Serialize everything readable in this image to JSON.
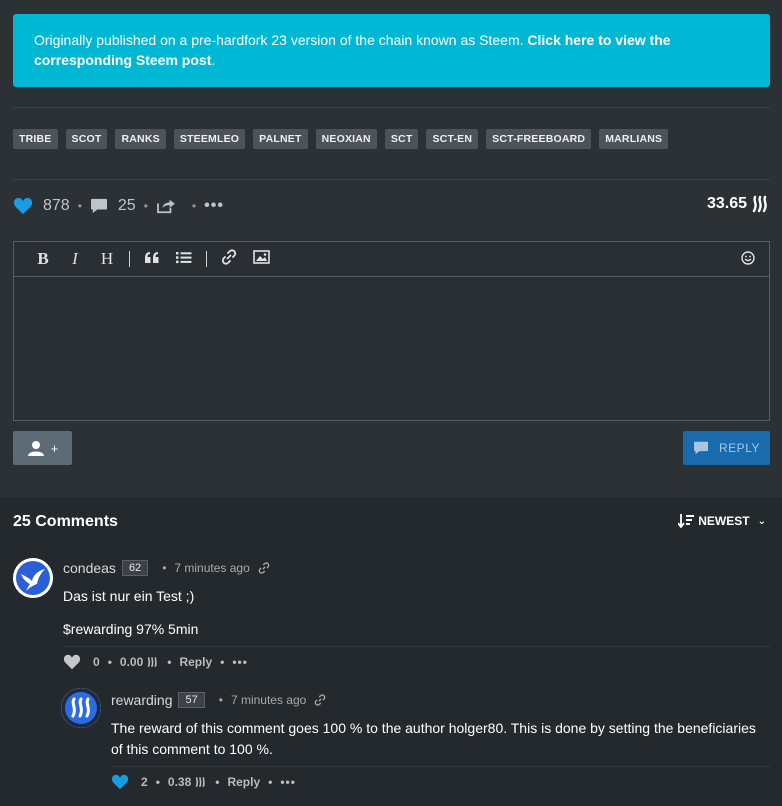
{
  "banner": {
    "text": "Originally published on a pre-hardfork 23 version of the chain known as Steem.",
    "link_text": "Click here to view the corresponding Steem post",
    "end": "."
  },
  "tags": [
    "TRIBE",
    "SCOT",
    "RANKS",
    "STEEMLEO",
    "PALNET",
    "NEOXIAN",
    "SCT",
    "SCT-EN",
    "SCT-FREEBOARD",
    "MARLIANS"
  ],
  "stats": {
    "votes": "878",
    "comments": "25",
    "payout": "33.65"
  },
  "editor": {
    "emoji_icon": "smile-icon"
  },
  "buttons": {
    "user_plus": "+",
    "reply": "REPLY"
  },
  "comments": {
    "heading": "25 Comments",
    "sort_label": "NEWEST",
    "items": [
      {
        "author": "condeas",
        "rep": "62",
        "time": "7 minutes ago",
        "lines": [
          "Das ist nur ein Test ;)",
          "$rewarding 97% 5min"
        ],
        "votes": "0",
        "payout": "0.00",
        "reply": "Reply"
      },
      {
        "author": "rewarding",
        "rep": "57",
        "time": "7 minutes ago",
        "lines": [
          "The reward of this comment goes 100 % to the author holger80. This is done by setting the beneficiaries",
          "of this comment to 100 %."
        ],
        "votes": "2",
        "payout": "0.38",
        "reply": "Reply"
      }
    ]
  },
  "colors": {
    "accent": "#00b8d4",
    "heart": "#1a9be6",
    "reply_button": "#1a6aae"
  }
}
